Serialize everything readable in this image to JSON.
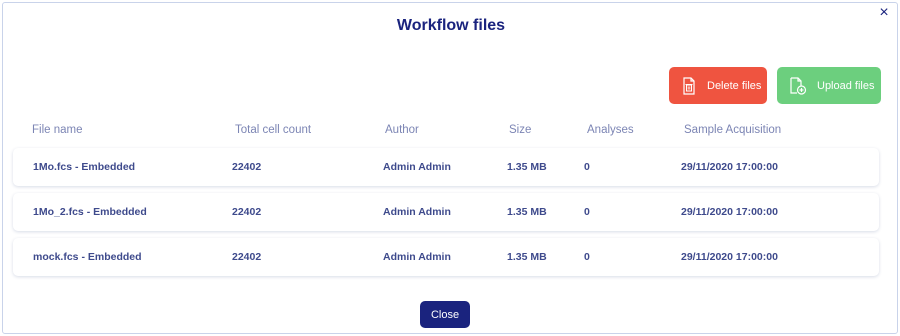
{
  "modal": {
    "title": "Workflow files",
    "close_icon": "×"
  },
  "actions": {
    "delete_label": "Delete files",
    "upload_label": "Upload files"
  },
  "table": {
    "headers": [
      "File name",
      "Total cell count",
      "Author",
      "Size",
      "Analyses",
      "Sample Acquisition"
    ],
    "rows": [
      [
        "1Mo.fcs - Embedded",
        "22402",
        "Admin Admin",
        "1.35 MB",
        "0",
        "29/11/2020 17:00:00"
      ],
      [
        "1Mo_2.fcs - Embedded",
        "22402",
        "Admin Admin",
        "1.35 MB",
        "0",
        "29/11/2020 17:00:00"
      ],
      [
        "mock.fcs - Embedded",
        "22402",
        "Admin Admin",
        "1.35 MB",
        "0",
        "29/11/2020 17:00:00"
      ]
    ]
  },
  "footer": {
    "close_label": "Close"
  },
  "colors": {
    "primary": "#1a237e",
    "delete": "#ef5440",
    "upload": "#6ccf7e",
    "header_text": "#7c85b4",
    "cell_text": "#3e4a8c"
  },
  "icons": {
    "delete": "trash-file-icon",
    "upload": "file-upload-icon",
    "close": "close-icon"
  }
}
